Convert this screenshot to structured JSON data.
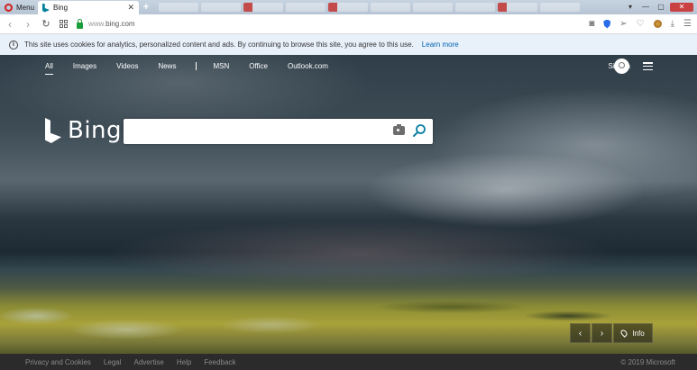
{
  "browser": {
    "menu_label": "Menu",
    "active_tab_title": "Bing",
    "close_glyph": "✕",
    "new_tab_glyph": "+",
    "url_prefix": "www.",
    "url_domain": "bing.com"
  },
  "cookie_notice": {
    "text": "This site uses cookies for analytics, personalized content and ads. By continuing to browse this site, you agree to this use.",
    "link_label": "Learn more"
  },
  "nav": {
    "items": [
      "All",
      "Images",
      "Videos",
      "News",
      "MSN",
      "Office",
      "Outlook.com"
    ],
    "signin_label": "Sign in"
  },
  "logo": {
    "wordmark": "Bing"
  },
  "search": {
    "value": "",
    "placeholder": ""
  },
  "image_controls": {
    "prev": "‹",
    "next": "›",
    "info_label": "Info"
  },
  "footer": {
    "links": [
      "Privacy and Cookies",
      "Legal",
      "Advertise",
      "Help",
      "Feedback"
    ],
    "copyright": "© 2019 Microsoft"
  },
  "colors": {
    "accent": "#00809d",
    "link": "#0063b1",
    "cookie_bg": "#e8f0fa",
    "footer_bg": "#2b2b2b"
  },
  "icons": [
    "opera-icon",
    "bing-favicon",
    "back-icon",
    "forward-icon",
    "reload-icon",
    "speed-dial-icon",
    "lock-icon",
    "snapshot-icon",
    "adblock-shield-icon",
    "send-icon",
    "heart-icon",
    "extension-icon",
    "download-icon",
    "easy-setup-icon",
    "info-icon",
    "avatar-icon",
    "hamburger-icon",
    "camera-icon",
    "search-icon",
    "location-pin-icon"
  ]
}
